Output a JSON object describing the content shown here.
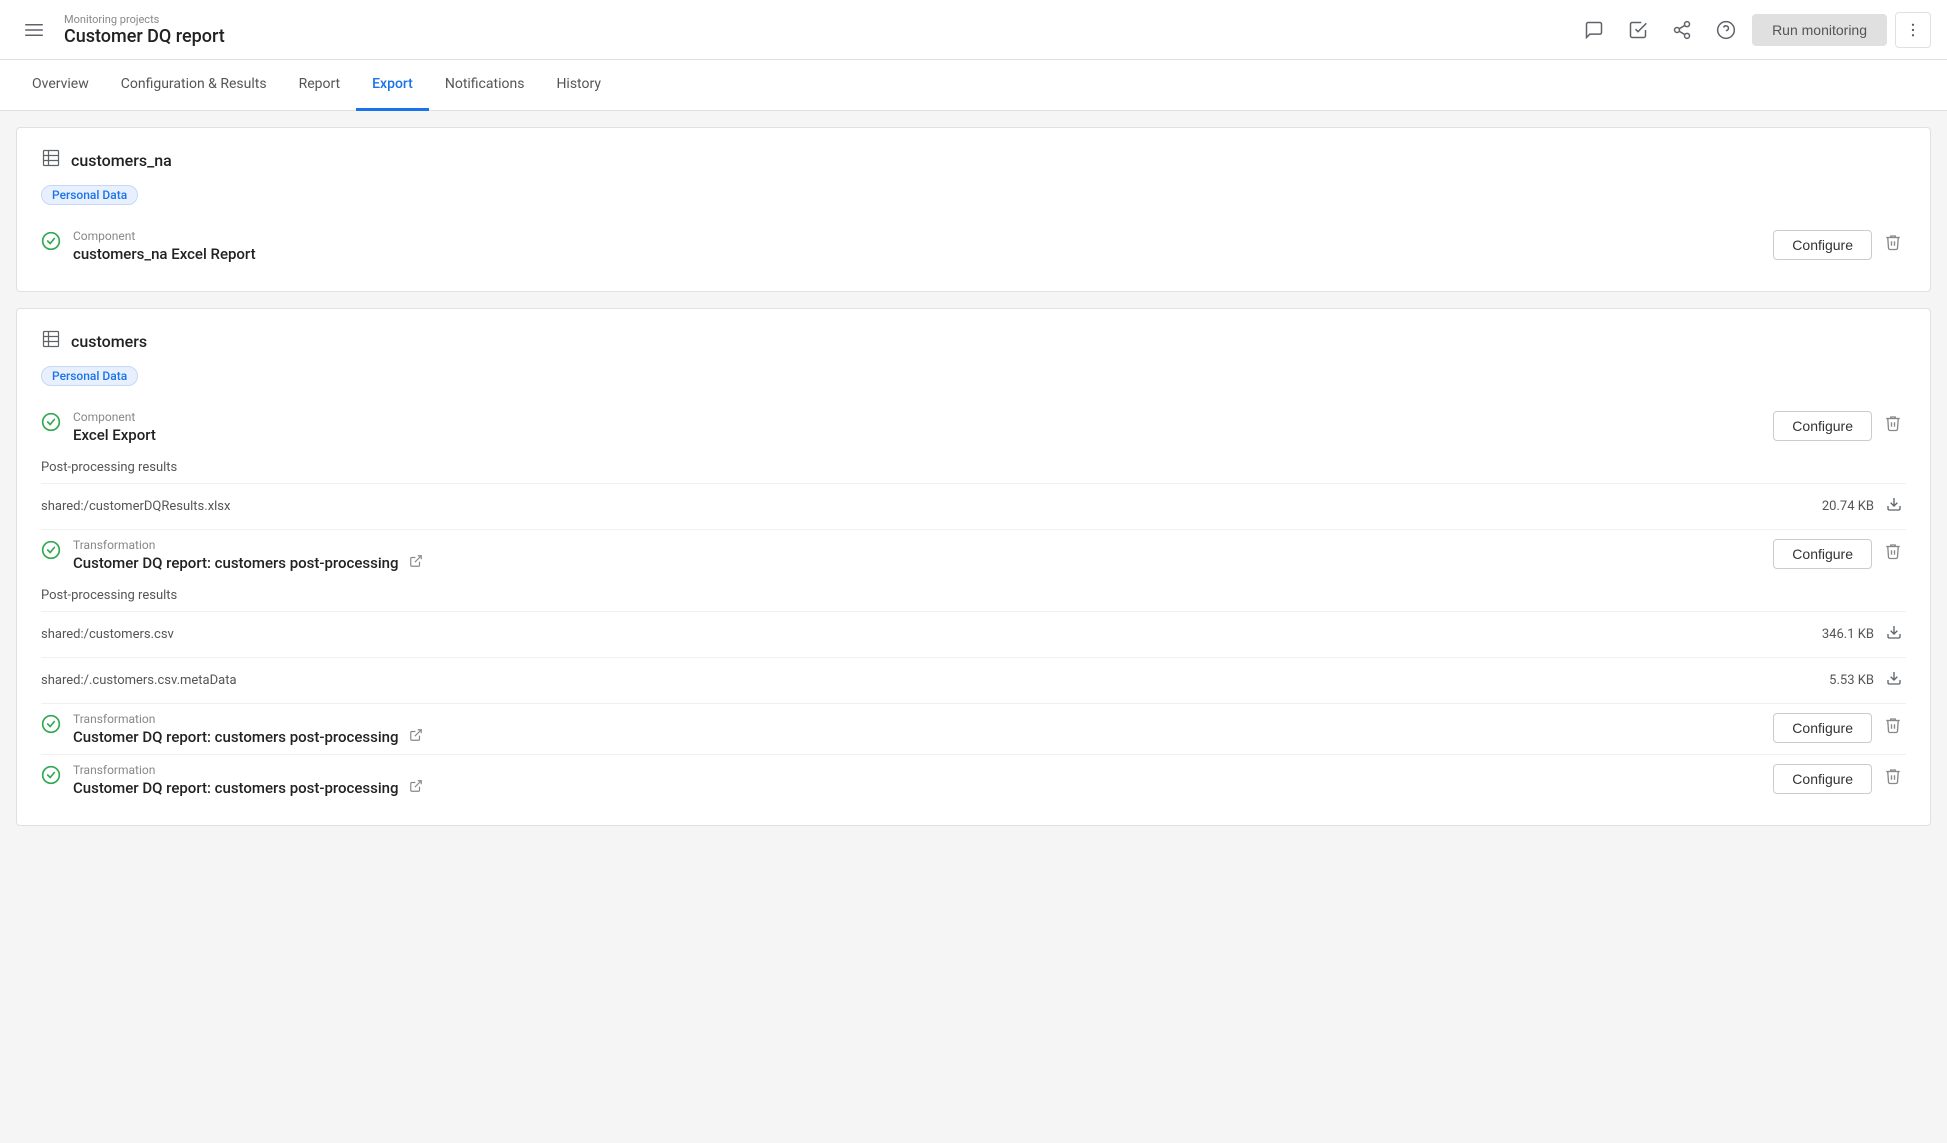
{
  "header": {
    "subtitle": "Monitoring projects",
    "title": "Customer DQ report",
    "menu_icon": "☰",
    "actions": {
      "comment_icon": "💬",
      "check_icon": "☑",
      "share_icon": "⤴",
      "help_icon": "?",
      "run_button_label": "Run monitoring",
      "more_icon": "⋮"
    }
  },
  "nav": {
    "tabs": [
      {
        "label": "Overview",
        "active": false
      },
      {
        "label": "Configuration & Results",
        "active": false
      },
      {
        "label": "Report",
        "active": false
      },
      {
        "label": "Export",
        "active": true
      },
      {
        "label": "Notifications",
        "active": false
      },
      {
        "label": "History",
        "active": false
      }
    ]
  },
  "sections": [
    {
      "id": "customers_na",
      "title": "customers_na",
      "badge": "Personal Data",
      "components": [
        {
          "type": "component",
          "label": "Component",
          "name": "customers_na Excel Report",
          "status": "ok"
        }
      ],
      "post_processing": []
    },
    {
      "id": "customers",
      "title": "customers",
      "badge": "Personal Data",
      "components": [
        {
          "type": "component",
          "label": "Component",
          "name": "Excel Export",
          "status": "ok",
          "post_processing": {
            "label": "Post-processing results",
            "files": [
              {
                "path": "shared:/customerDQResults.xlsx",
                "size": "20.74 KB"
              }
            ]
          }
        },
        {
          "type": "transformation",
          "label": "Transformation",
          "name": "Customer DQ report: customers post-processing",
          "status": "ok",
          "has_external_link": true,
          "post_processing": {
            "label": "Post-processing results",
            "files": [
              {
                "path": "shared:/customers.csv",
                "size": "346.1 KB"
              },
              {
                "path": "shared:/.customers.csv.metaData",
                "size": "5.53 KB"
              }
            ]
          }
        },
        {
          "type": "transformation",
          "label": "Transformation",
          "name": "Customer DQ report: customers post-processing",
          "status": "ok",
          "has_external_link": true,
          "post_processing": null
        },
        {
          "type": "transformation",
          "label": "Transformation",
          "name": "Customer DQ report: customers post-processing",
          "status": "ok",
          "has_external_link": true,
          "post_processing": null
        }
      ]
    }
  ],
  "icons": {
    "check_circle": "✅",
    "table": "⊞",
    "delete": "🗑",
    "download": "⬇",
    "external_link": "⧉"
  },
  "buttons": {
    "configure": "Configure"
  }
}
